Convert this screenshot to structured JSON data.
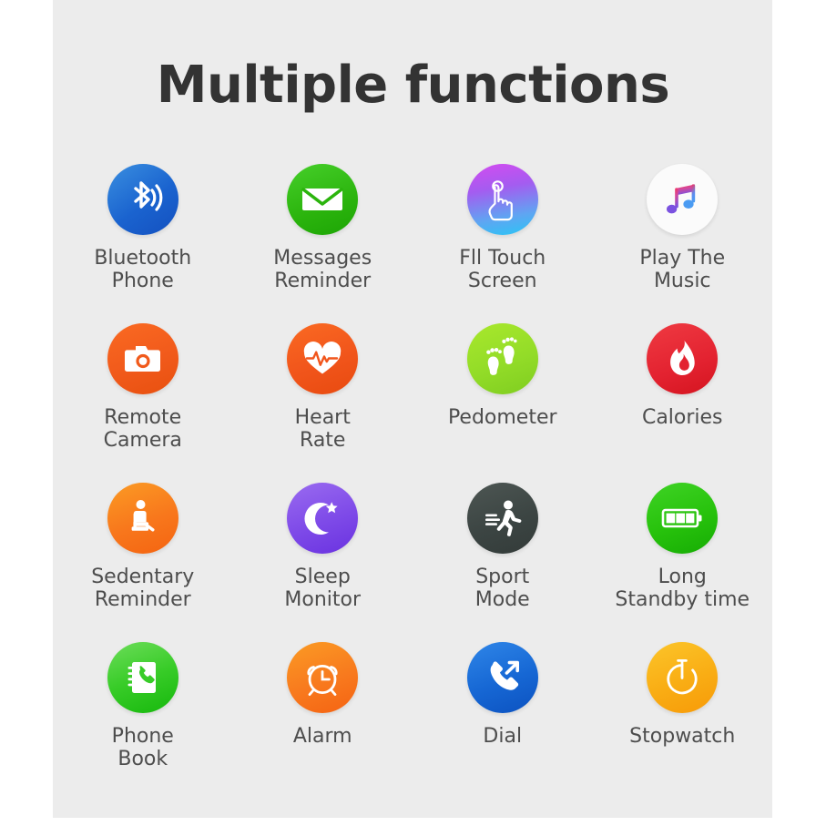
{
  "title": "Multiple functions",
  "colors": {
    "background": "#ffffff",
    "panel": "#ececec",
    "title_text": "#333333",
    "label_text": "#4d4d4d"
  },
  "grid": {
    "columns": 4,
    "rows": 4,
    "items": [
      {
        "icon": "bluetooth-icon",
        "label": "Bluetooth\nPhone",
        "circle_color": "#1a63cf",
        "glyph_color": "#ffffff"
      },
      {
        "icon": "envelope-icon",
        "label": "Messages\nReminder",
        "circle_color": "#2bb40d",
        "glyph_color": "#ffffff"
      },
      {
        "icon": "touch-hand-icon",
        "label": "Fll Touch\nScreen",
        "circle_color": "#a45cf0",
        "glyph_color": "#ffffff"
      },
      {
        "icon": "music-note-icon",
        "label": "Play The\nMusic",
        "circle_color": "#fbfbfb",
        "glyph_color": "#f0426a"
      },
      {
        "icon": "camera-icon",
        "label": "Remote\nCamera",
        "circle_color": "#f15a1b",
        "glyph_color": "#ffffff"
      },
      {
        "icon": "heart-pulse-icon",
        "label": "Heart\nRate",
        "circle_color": "#f1551b",
        "glyph_color": "#ffffff"
      },
      {
        "icon": "footprints-icon",
        "label": "Pedometer",
        "circle_color": "#93dc28",
        "glyph_color": "#ffffff"
      },
      {
        "icon": "flame-icon",
        "label": "Calories",
        "circle_color": "#e32230",
        "glyph_color": "#ffffff"
      },
      {
        "icon": "sitting-person-icon",
        "label": "Sedentary\nReminder",
        "circle_color": "#f8771c",
        "glyph_color": "#ffffff"
      },
      {
        "icon": "moon-star-icon",
        "label": "Sleep\nMonitor",
        "circle_color": "#7e4ae8",
        "glyph_color": "#ffffff"
      },
      {
        "icon": "running-person-icon",
        "label": "Sport\nMode",
        "circle_color": "#3c4543",
        "glyph_color": "#ffffff"
      },
      {
        "icon": "battery-icon",
        "label": "Long\nStandby time",
        "circle_color": "#27c20c",
        "glyph_color": "#ffffff"
      },
      {
        "icon": "phonebook-icon",
        "label": "Phone\nBook",
        "circle_color": "#38cc28",
        "glyph_color": "#ffffff"
      },
      {
        "icon": "alarm-clock-icon",
        "label": "Alarm",
        "circle_color": "#f87a1e",
        "glyph_color": "#ffffff"
      },
      {
        "icon": "dial-out-icon",
        "label": "Dial",
        "circle_color": "#1667d4",
        "glyph_color": "#ffffff"
      },
      {
        "icon": "stopwatch-icon",
        "label": "Stopwatch",
        "circle_color": "#f9ad14",
        "glyph_color": "#ffffff"
      }
    ]
  }
}
